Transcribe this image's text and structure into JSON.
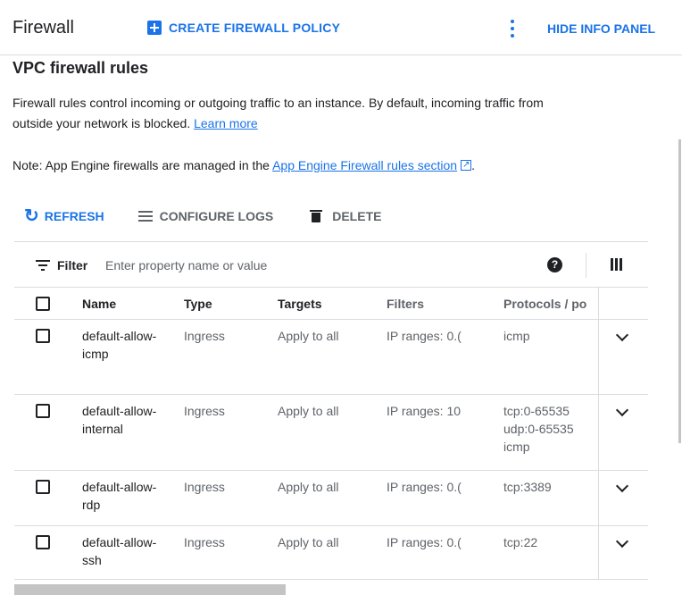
{
  "header": {
    "title": "Firewall",
    "create_label": "CREATE FIREWALL POLICY",
    "hide_info_label": "HIDE INFO PANEL",
    "accent": "#1a73e8"
  },
  "section": {
    "title": "VPC firewall rules",
    "description": "Firewall rules control incoming or outgoing traffic to an instance. By default, incoming traffic from outside your network is blocked.",
    "learn_more": "Learn more",
    "note_prefix": "Note: App Engine firewalls are managed in the",
    "note_link": "App Engine Firewall rules section",
    "note_suffix": "."
  },
  "toolbar": {
    "refresh": "REFRESH",
    "configure_logs": "CONFIGURE LOGS",
    "delete": "DELETE"
  },
  "filter": {
    "label": "Filter",
    "placeholder": "Enter property name or value",
    "help": "?"
  },
  "table": {
    "columns": [
      "Name",
      "Type",
      "Targets",
      "Filters",
      "Protocols / po"
    ],
    "rows": [
      {
        "name": "default-allow-icmp",
        "type": "Ingress",
        "targets": "Apply to all",
        "filters": "IP ranges: 0.(",
        "protocols": "icmp"
      },
      {
        "name": "default-allow-internal",
        "type": "Ingress",
        "targets": "Apply to all",
        "filters": "IP ranges: 10",
        "protocols": "tcp:0-65535\nudp:0-65535\nicmp"
      },
      {
        "name": "default-allow-rdp",
        "type": "Ingress",
        "targets": "Apply to all",
        "filters": "IP ranges: 0.(",
        "protocols": "tcp:3389"
      },
      {
        "name": "default-allow-ssh",
        "type": "Ingress",
        "targets": "Apply to all",
        "filters": "IP ranges: 0.(",
        "protocols": "tcp:22"
      }
    ]
  }
}
